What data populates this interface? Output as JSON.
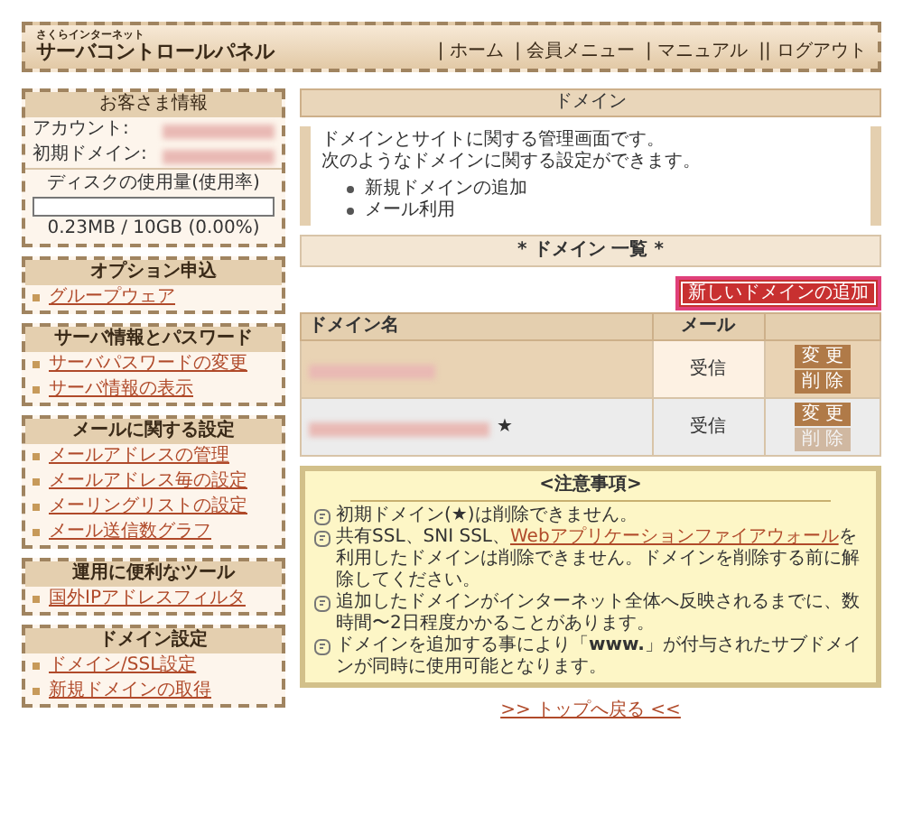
{
  "header": {
    "brand_small": "さくらインターネット",
    "brand": "サーバコントロールパネル",
    "nav": [
      "| ホーム",
      "| 会員メニュー",
      "| マニュアル",
      "|| ログアウト"
    ]
  },
  "sidebar": {
    "account": {
      "title": "お客さま情報",
      "fields": [
        {
          "label": "アカウント:"
        },
        {
          "label": "初期ドメイン:"
        }
      ],
      "disk": {
        "label": "ディスクの使用量(使用率)",
        "level": 0,
        "reading": "0.23MB / 10GB (0.00%)"
      }
    },
    "sections": [
      {
        "title": "オプション申込",
        "items": [
          "グループウェア"
        ]
      },
      {
        "title": "サーバ情報とパスワード",
        "items": [
          "サーバパスワードの変更",
          "サーバ情報の表示"
        ]
      },
      {
        "title": "メールに関する設定",
        "items": [
          "メールアドレスの管理",
          "メールアドレス毎の設定",
          "メーリングリストの設定",
          "メール送信数グラフ"
        ]
      },
      {
        "title": "運用に便利なツール",
        "items": [
          "国外IPアドレスフィルタ"
        ]
      },
      {
        "title": "ドメイン設定",
        "items": [
          "ドメイン/SSL設定",
          "新規ドメインの取得"
        ]
      }
    ]
  },
  "main": {
    "title": "ドメイン",
    "intro": [
      "ドメインとサイトに関する管理画面です。",
      "次のようなドメインに関する設定ができます。"
    ],
    "intro_items": [
      "新規ドメインの追加",
      "メール利用"
    ],
    "list_title": "* ドメイン 一覧 *",
    "add_button": "新しいドメインの追加",
    "table": {
      "columns": [
        "ドメイン名",
        "メール",
        ""
      ],
      "rows": [
        {
          "primary": false,
          "mail": "受信",
          "edit": "変 更",
          "delete": "削 除",
          "delete_disabled": false
        },
        {
          "primary": true,
          "star": "★",
          "mail": "受信",
          "edit": "変 更",
          "delete": "削 除",
          "delete_disabled": true
        }
      ]
    },
    "notes": {
      "title": "<注意事項>",
      "items": [
        {
          "text": "初期ドメイン(★)は削除できません。"
        },
        {
          "before": "共有SSL、SNI SSL、",
          "link": "Webアプリケーションファイアウォール",
          "text": "を利用したドメインは削除できません。ドメインを削除する前に解除してください。"
        },
        {
          "text": "追加したドメインがインターネット全体へ反映されるまでに、数時間〜2日程度かかることがあります。"
        },
        {
          "text": "ドメインを追加する事により「**www.**」が付与されたサブドメインが同時に使用可能となります。"
        }
      ]
    },
    "back_link": ">> トップへ戻る <<"
  }
}
